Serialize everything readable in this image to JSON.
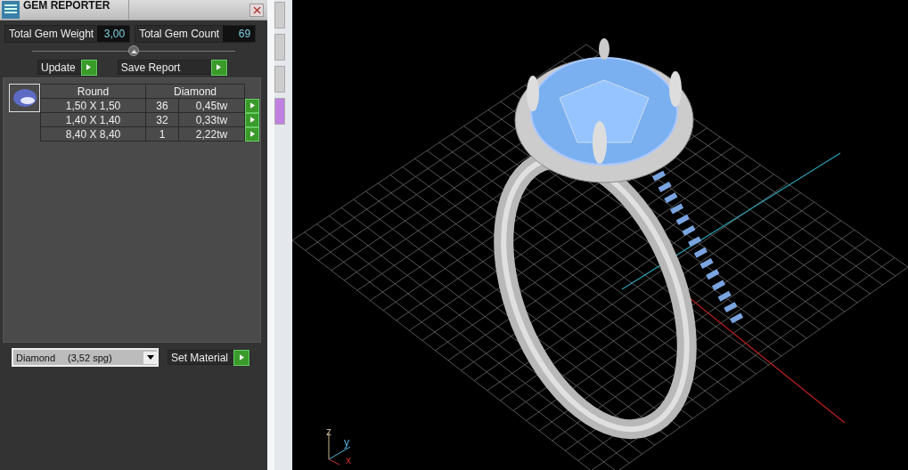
{
  "panel": {
    "title": "GEM REPORTER",
    "stats": [
      {
        "label": "Total Gem Weight",
        "value": "3,00"
      },
      {
        "label": "Total Gem Count",
        "value": "69"
      }
    ],
    "buttons": [
      "Update",
      "Save Report"
    ],
    "table": {
      "columns": [
        "Round",
        "Diamond"
      ],
      "rows": [
        {
          "size": "1,50 X 1,50",
          "count": "36",
          "weight": "0,45tw"
        },
        {
          "size": "1,40 X 1,40",
          "count": "32",
          "weight": "0,33tw"
        },
        {
          "size": "8,40 X 8,40",
          "count": "1",
          "weight": "2,22tw"
        }
      ]
    },
    "material": {
      "name": "Diamond",
      "density": "(3,52 spg)"
    },
    "set_button": "Set Material"
  },
  "viewport": {
    "axes": [
      "z",
      "y",
      "x"
    ]
  }
}
